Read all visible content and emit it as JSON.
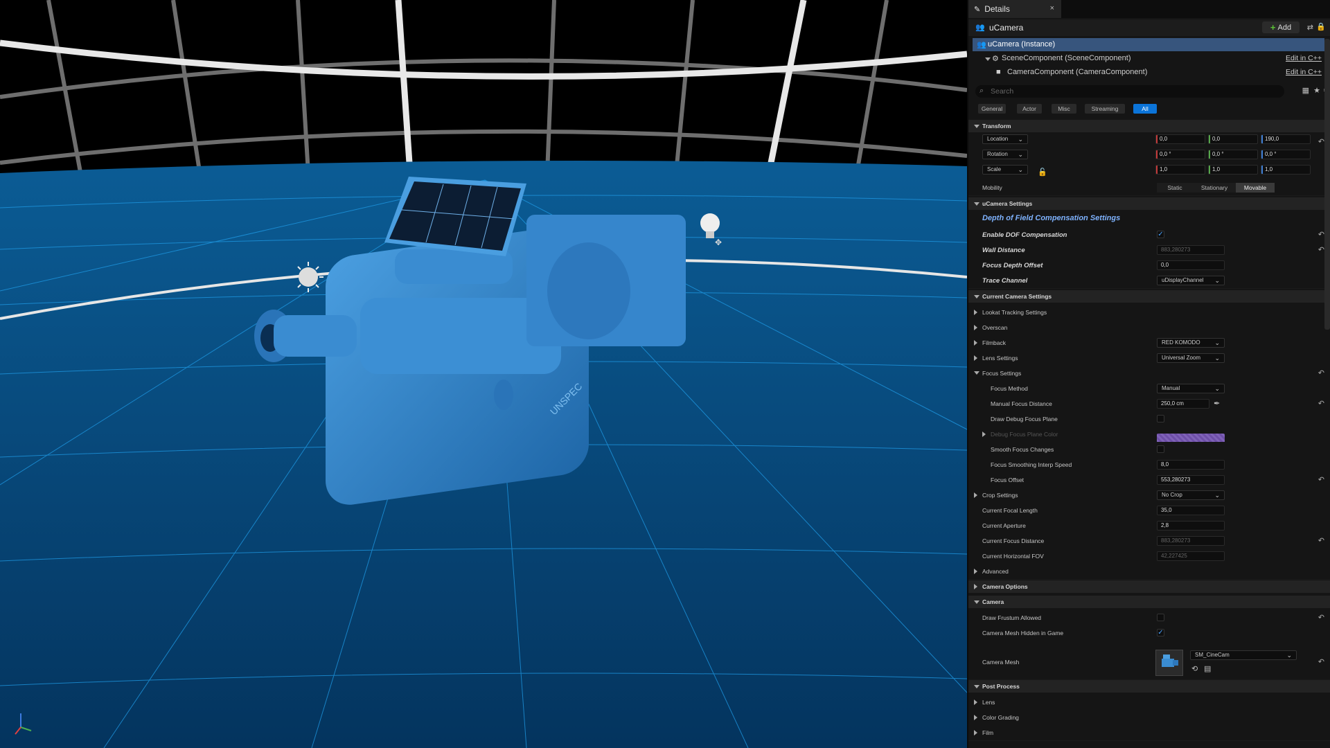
{
  "details": {
    "tab_title": "Details",
    "tab_close": "×",
    "actor_name": "uCamera",
    "add_label": "Add",
    "components": [
      {
        "label": "uCamera (Instance)",
        "edit": ""
      },
      {
        "label": "SceneComponent (SceneComponent)",
        "edit": "Edit in C++"
      },
      {
        "label": "CameraComponent (CameraComponent)",
        "edit": "Edit in C++"
      }
    ],
    "search_placeholder": "Search",
    "filters": [
      "General",
      "Actor",
      "Misc",
      "Streaming",
      "All"
    ],
    "active_filter": "All"
  },
  "transform": {
    "title": "Transform",
    "location_label": "Location",
    "location": [
      "0,0",
      "0,0",
      "190,0"
    ],
    "rotation_label": "Rotation",
    "rotation": [
      "0,0 °",
      "0,0 °",
      "0,0 °"
    ],
    "scale_label": "Scale",
    "scale": [
      "1,0",
      "1,0",
      "1,0"
    ],
    "mobility_label": "Mobility",
    "mobility_options": [
      "Static",
      "Stationary",
      "Movable"
    ],
    "mobility_selected": "Movable"
  },
  "ucamera_settings": {
    "title": "uCamera Settings",
    "subheader": "Depth of Field Compensation Settings",
    "enable_dof_label": "Enable DOF Compensation",
    "wall_distance_label": "Wall Distance",
    "wall_distance": "883,280273",
    "focus_depth_offset_label": "Focus Depth Offset",
    "focus_depth_offset": "0,0",
    "trace_channel_label": "Trace Channel",
    "trace_channel": "uDisplayChannel"
  },
  "current_camera": {
    "title": "Current Camera Settings",
    "lookat_label": "Lookat Tracking Settings",
    "overscan_label": "Overscan",
    "filmback_label": "Filmback",
    "filmback": "RED KOMODO",
    "lens_label": "Lens Settings",
    "lens": "Universal Zoom",
    "focus_label": "Focus Settings",
    "focus_method_label": "Focus Method",
    "focus_method": "Manual",
    "manual_focus_label": "Manual Focus Distance",
    "manual_focus": "250,0 cm",
    "draw_debug_label": "Draw Debug Focus Plane",
    "debug_color_label": "Debug Focus Plane Color",
    "smooth_label": "Smooth Focus Changes",
    "smoothing_speed_label": "Focus Smoothing Interp Speed",
    "smoothing_speed": "8,0",
    "focus_offset_label": "Focus Offset",
    "focus_offset": "553,280273",
    "crop_label": "Crop Settings",
    "crop": "No Crop",
    "focal_length_label": "Current Focal Length",
    "focal_length": "35,0",
    "aperture_label": "Current Aperture",
    "aperture": "2,8",
    "focus_distance_label": "Current Focus Distance",
    "focus_distance": "883,280273",
    "hfov_label": "Current Horizontal FOV",
    "hfov": "42,227425",
    "advanced_label": "Advanced"
  },
  "camera_options": {
    "title": "Camera Options"
  },
  "camera": {
    "title": "Camera",
    "frustum_label": "Draw Frustum Allowed",
    "mesh_hidden_label": "Camera Mesh Hidden in Game",
    "mesh_label": "Camera Mesh",
    "mesh": "SM_CineCam"
  },
  "post_process": {
    "title": "Post Process",
    "items": [
      "Lens",
      "Color Grading",
      "Film"
    ]
  },
  "viewport": {
    "camera_text": "UNSPEC"
  },
  "colors": {
    "accent": "#0b74d9",
    "selection": "#37557d",
    "viewport_blue": "#0a4a7c",
    "camera_blue": "#2f7fc4"
  }
}
